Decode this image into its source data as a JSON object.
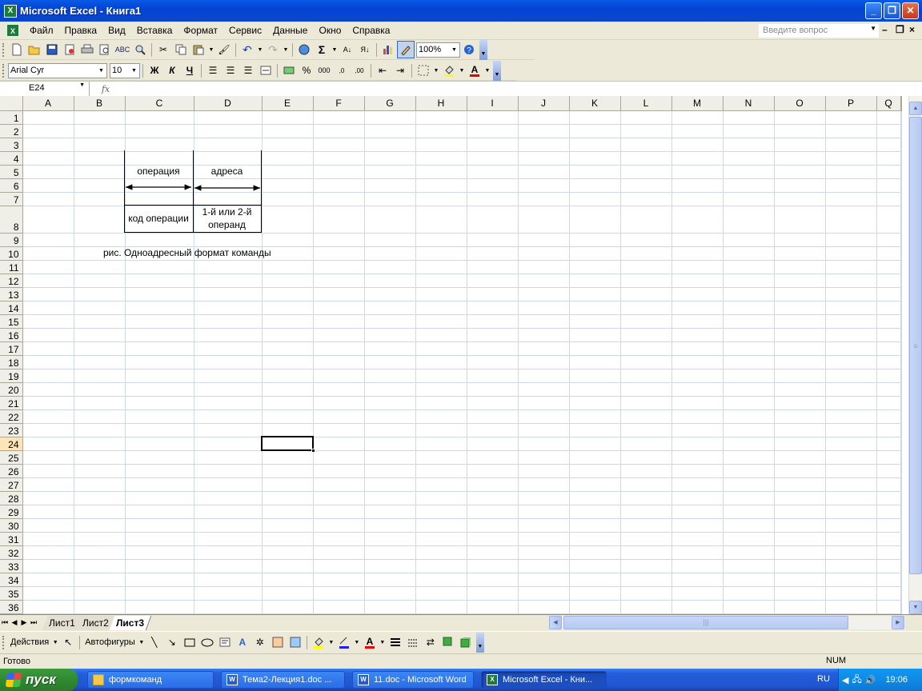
{
  "window": {
    "title": "Microsoft Excel - Книга1"
  },
  "menu": {
    "items": [
      "Файл",
      "Правка",
      "Вид",
      "Вставка",
      "Формат",
      "Сервис",
      "Данные",
      "Окно",
      "Справка"
    ],
    "help_placeholder": "Введите вопрос"
  },
  "standard_toolbar": {
    "zoom": "100%"
  },
  "formatting_toolbar": {
    "font": "Arial Cyr",
    "size": "10",
    "bold": "Ж",
    "italic": "К",
    "underline": "Ч",
    "thousands": "000",
    "percent": "%"
  },
  "formula_bar": {
    "name_box": "E24",
    "fx": "fx",
    "content": ""
  },
  "sheet": {
    "columns": [
      "A",
      "B",
      "C",
      "D",
      "E",
      "F",
      "G",
      "H",
      "I",
      "J",
      "K",
      "L",
      "M",
      "N",
      "O",
      "P",
      "Q"
    ],
    "rows": [
      "1",
      "2",
      "3",
      "4",
      "5",
      "6",
      "7",
      "8",
      "9",
      "10",
      "11",
      "12",
      "13",
      "14",
      "15",
      "16",
      "17",
      "18",
      "19",
      "20",
      "21",
      "22",
      "23",
      "24",
      "25",
      "26",
      "27",
      "28",
      "29",
      "30",
      "31",
      "32",
      "33",
      "34",
      "35",
      "36"
    ],
    "active_cell": "E24",
    "diagram": {
      "op_label": "операция",
      "addr_label": "адреса",
      "opcode_label": "код операции",
      "operand_label_line1": "1-й или 2-й",
      "operand_label_line2": "операнд",
      "caption": "рис.  Одноадресный формат команды"
    }
  },
  "tabs": {
    "sheets": [
      "Лист1",
      "Лист2",
      "Лист3"
    ],
    "active": "Лист3"
  },
  "drawing_toolbar": {
    "actions": "Действия",
    "autoshapes": "Автофигуры"
  },
  "status": {
    "text": "Готово",
    "num": "NUM"
  },
  "taskbar": {
    "start": "пуск",
    "tasks": [
      "формкоманд",
      "Тема2-Лекция1.doc ...",
      "11.doc - Microsoft Word",
      "Microsoft Excel - Кни..."
    ],
    "lang": "RU",
    "clock": "19:06"
  }
}
